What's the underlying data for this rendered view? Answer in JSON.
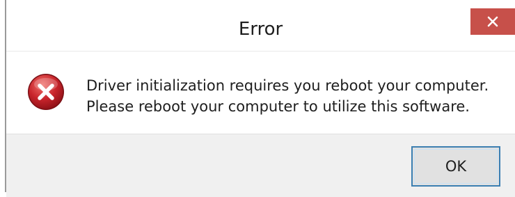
{
  "window": {
    "title": "Error",
    "close_icon": "close-x-icon"
  },
  "message": {
    "icon": "error-circle-x-icon",
    "line1": "Driver initialization requires you reboot your computer.",
    "line2": "Please reboot your computer to utilize this software."
  },
  "buttons": {
    "ok_label": "OK"
  },
  "colors": {
    "close_button": "#c7504a",
    "error_icon": "#c8242b",
    "ok_border": "#3c7fb1",
    "footer_bg": "#f0f0f0"
  }
}
